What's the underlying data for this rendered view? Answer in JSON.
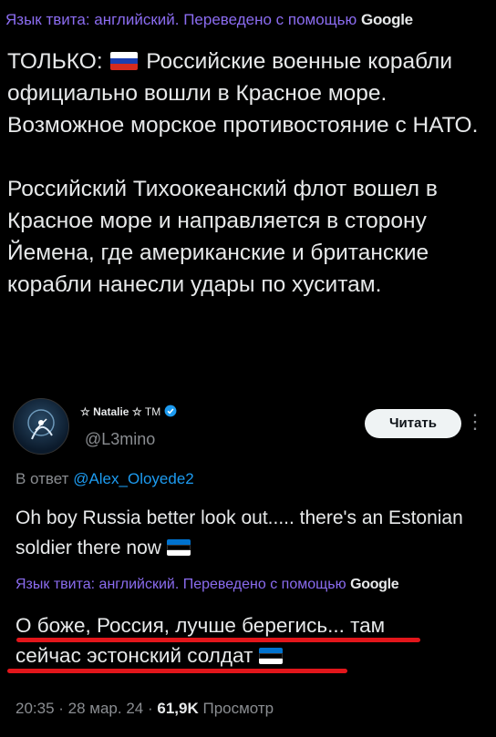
{
  "tweet": {
    "translation_note": "Язык твита: английский. Переведено с помощью",
    "translation_brand": "Google",
    "prefix": "ТОЛЬКО:",
    "line1_rest": "Российские военные корабли официально вошли в Красное море. Возможное морское противостояние с НАТО.",
    "paragraph2": "Российский Тихоокеанский флот вошел в Красное море и направляется в сторону Йемена, где американские и британские корабли нанесли удары по хуситам."
  },
  "reply": {
    "author_name": "Natalie",
    "author_badge": "TM",
    "handle": "@L3mino",
    "follow_label": "Читать",
    "more_icon": "⋮",
    "reply_to_prefix": "В ответ",
    "reply_to_handle": "@Alex_Oloyede2",
    "text": "Oh boy Russia better look out..... there's an Estonian soldier there now",
    "translation_note": "Язык твита: английский. Переведено с помощью",
    "translation_brand": "Google",
    "translated_line1": "О боже, Россия, лучше берегись... там",
    "translated_line2": "сейчас эстонский солдат",
    "meta_time": "20:35 · 28 мар. 24 ·",
    "views_count": "61,9K",
    "views_label": "Просмотр"
  },
  "colors": {
    "background": "#000000",
    "text": "#e7e9ea",
    "muted": "#8a8d91",
    "link": "#1d9bf0",
    "translation_label": "#8b6cf0",
    "underline": "#e2161b",
    "verified": "#1d9bf0"
  },
  "icons": {
    "flag_russia": "flag-russia-icon",
    "flag_estonia": "flag-estonia-icon",
    "verified": "verified-badge-icon",
    "star": "star-icon"
  }
}
